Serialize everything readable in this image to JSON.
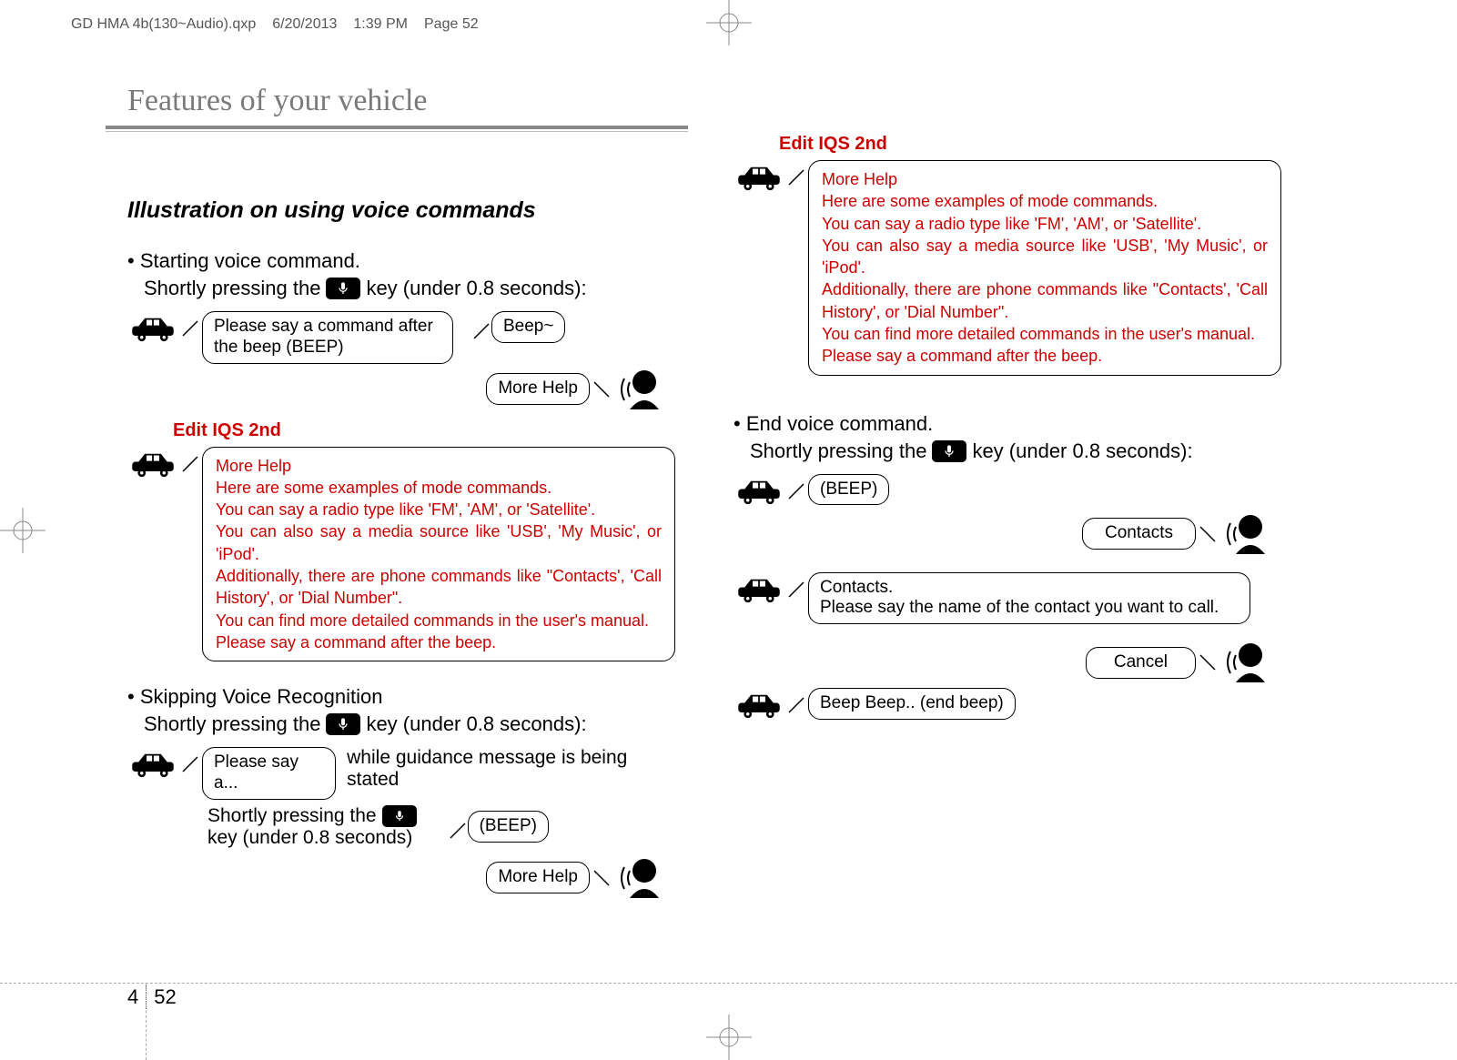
{
  "print_header": {
    "file": "GD HMA 4b(130~Audio).qxp",
    "date": "6/20/2013",
    "time": "1:39 PM",
    "page_label": "Page 52"
  },
  "chapter_title": "Features of your vehicle",
  "section_title_left": "Illustration on using voice commands",
  "start_voice": {
    "bullet": "• Starting voice command.",
    "press_prefix": "Shortly pressing the",
    "press_suffix": "key (under 0.8 seconds):",
    "car_prompt": "Please say a command after the beep (BEEP)",
    "beep": "Beep~",
    "more_help": "More Help"
  },
  "edit_label": "Edit IQS 2nd",
  "help_box": {
    "l1": "More Help",
    "l2": "Here are some examples of mode commands.",
    "l3": "You can say a radio type like 'FM', 'AM', or 'Satellite'.",
    "l4": "You can also say a media source like 'USB', 'My Music', or 'iPod'.",
    "l5": "Additionally, there are phone commands like \"Contacts', 'Call History', or 'Dial Number\".",
    "l6": "You can find more detailed commands in the user's manual.",
    "l7": "Please say a command after the beep."
  },
  "skip_voice": {
    "bullet": "• Skipping Voice Recognition",
    "press_prefix": "Shortly pressing the",
    "press_suffix": "key (under 0.8 seconds):",
    "say_a": "Please say a...",
    "guidance": "while guidance message is being stated",
    "short_press": "Shortly pressing the",
    "short_press2": "key (under 0.8 seconds)",
    "beep": "(BEEP)",
    "more_help": "More Help"
  },
  "end_voice": {
    "bullet": "• End voice command.",
    "press_prefix": "Shortly pressing the",
    "press_suffix": "key (under 0.8 seconds):",
    "beep": "(BEEP)",
    "contacts": "Contacts",
    "contacts_prompt_l1": "Contacts.",
    "contacts_prompt_l2": "Please say the name of the contact you want to call.",
    "cancel": "Cancel",
    "end_beep": "Beep Beep.. (end beep)"
  },
  "footer": {
    "chapter": "4",
    "page": "52"
  }
}
